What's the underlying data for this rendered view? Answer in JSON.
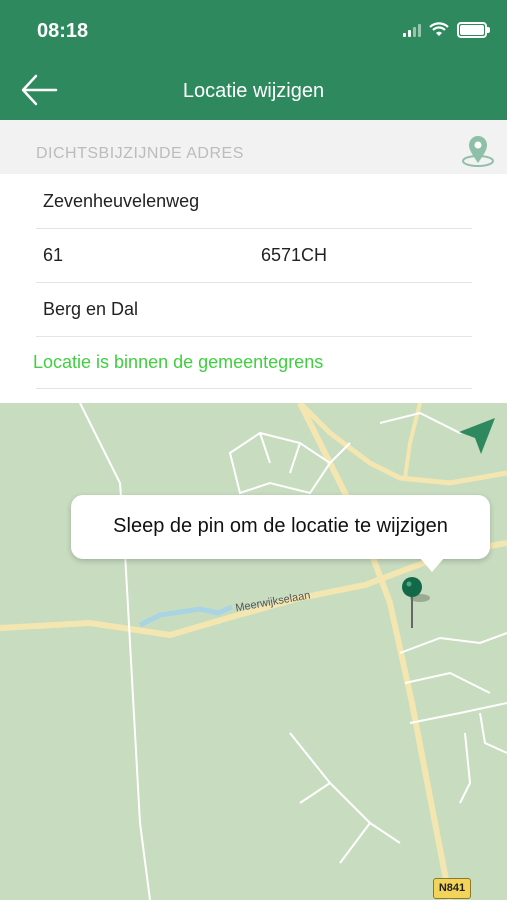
{
  "status_bar": {
    "time": "08:18"
  },
  "header": {
    "title": "Locatie wijzigen"
  },
  "address": {
    "section_label": "DICHTSBIJZIJNDE ADRES",
    "street": "Zevenheuvelenweg",
    "house_number": "61",
    "postal_code": "6571CH",
    "city": "Berg en Dal"
  },
  "status": {
    "message": "Locatie is binnen de gemeentegrens"
  },
  "map": {
    "tooltip": "Sleep de pin om de locatie te wijzigen",
    "road_labels": {
      "meerwijkselaan": "Meerwijkselaan",
      "n841": "N841"
    }
  },
  "colors": {
    "primary": "#2e8a5e",
    "success": "#3fcf3f",
    "map_bg": "#c8dcc0",
    "road": "#f4e6b0"
  }
}
